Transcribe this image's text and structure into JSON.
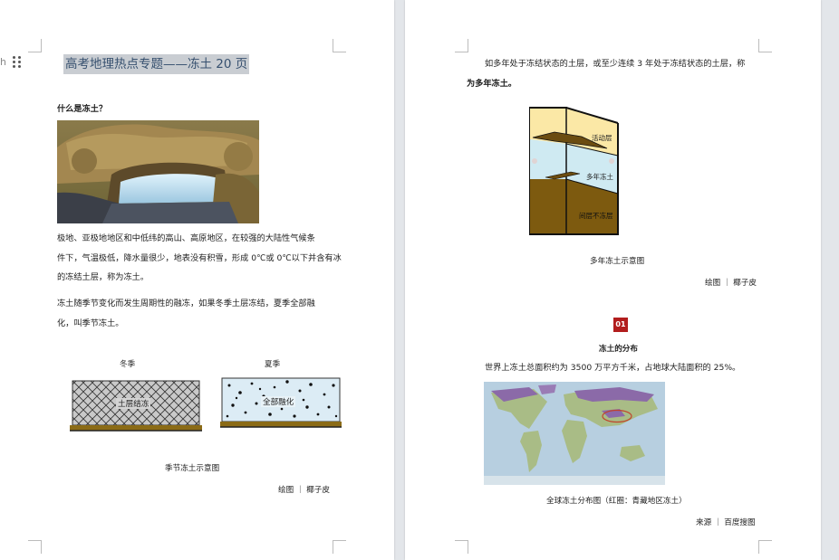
{
  "left": {
    "heading_fragment": "h",
    "title": "高考地理热点专题——冻土 20 页",
    "question": "什么是冻土？",
    "para1_lines": [
      "极地、亚极地地区和中低纬的高山、高原地区，在较强的大陆性气候条",
      "件下，气温极低，降水量很少，地表没有积雪，形成 0℃或 0℃以下并含有冰",
      "的冻结土层，称为冻土。"
    ],
    "para2_lines": [
      "冻土随季节变化而发生周期性的融冻，如果冬季土层冻结，夏季全部融",
      "化，叫季节冻土。"
    ],
    "winter_label": "冬季",
    "summer_label": "夏季",
    "winter_box_label": "土层结冻",
    "summer_box_label": "全部融化",
    "seasonal_caption": "季节冻土示意图",
    "credit": "绘图 ｜ 椰子皮"
  },
  "right": {
    "intro_lines": [
      "如多年处于冻结状态的土层，或至少连续 3 年处于冻结状态的土层，称",
      "为多年冻土。"
    ],
    "layer_active": "活动层",
    "layer_permafrost": "多年冻土",
    "layer_unfrozen": "间层不冻层",
    "permafrost_caption": "多年冻土示意图",
    "credit1": "绘图 ｜ 椰子皮",
    "section_number": "01",
    "section_title": "冻土的分布",
    "distribution_text": "世界上冻土总面积约为 3500 万平方千米，占地球大陆面积的 25%。",
    "map_caption": "全球冻土分布图（红圈：青藏地区冻土）",
    "credit2": "来源 ｜ 百度搜图"
  },
  "colors": {
    "title_highlight": "#c9cdd2",
    "title_text": "#36506f",
    "badge": "#b21d1d",
    "active_layer": "#fbe8a6",
    "permafrost_layer": "#cfeaf2",
    "unfrozen_layer": "#7d5a0f"
  }
}
